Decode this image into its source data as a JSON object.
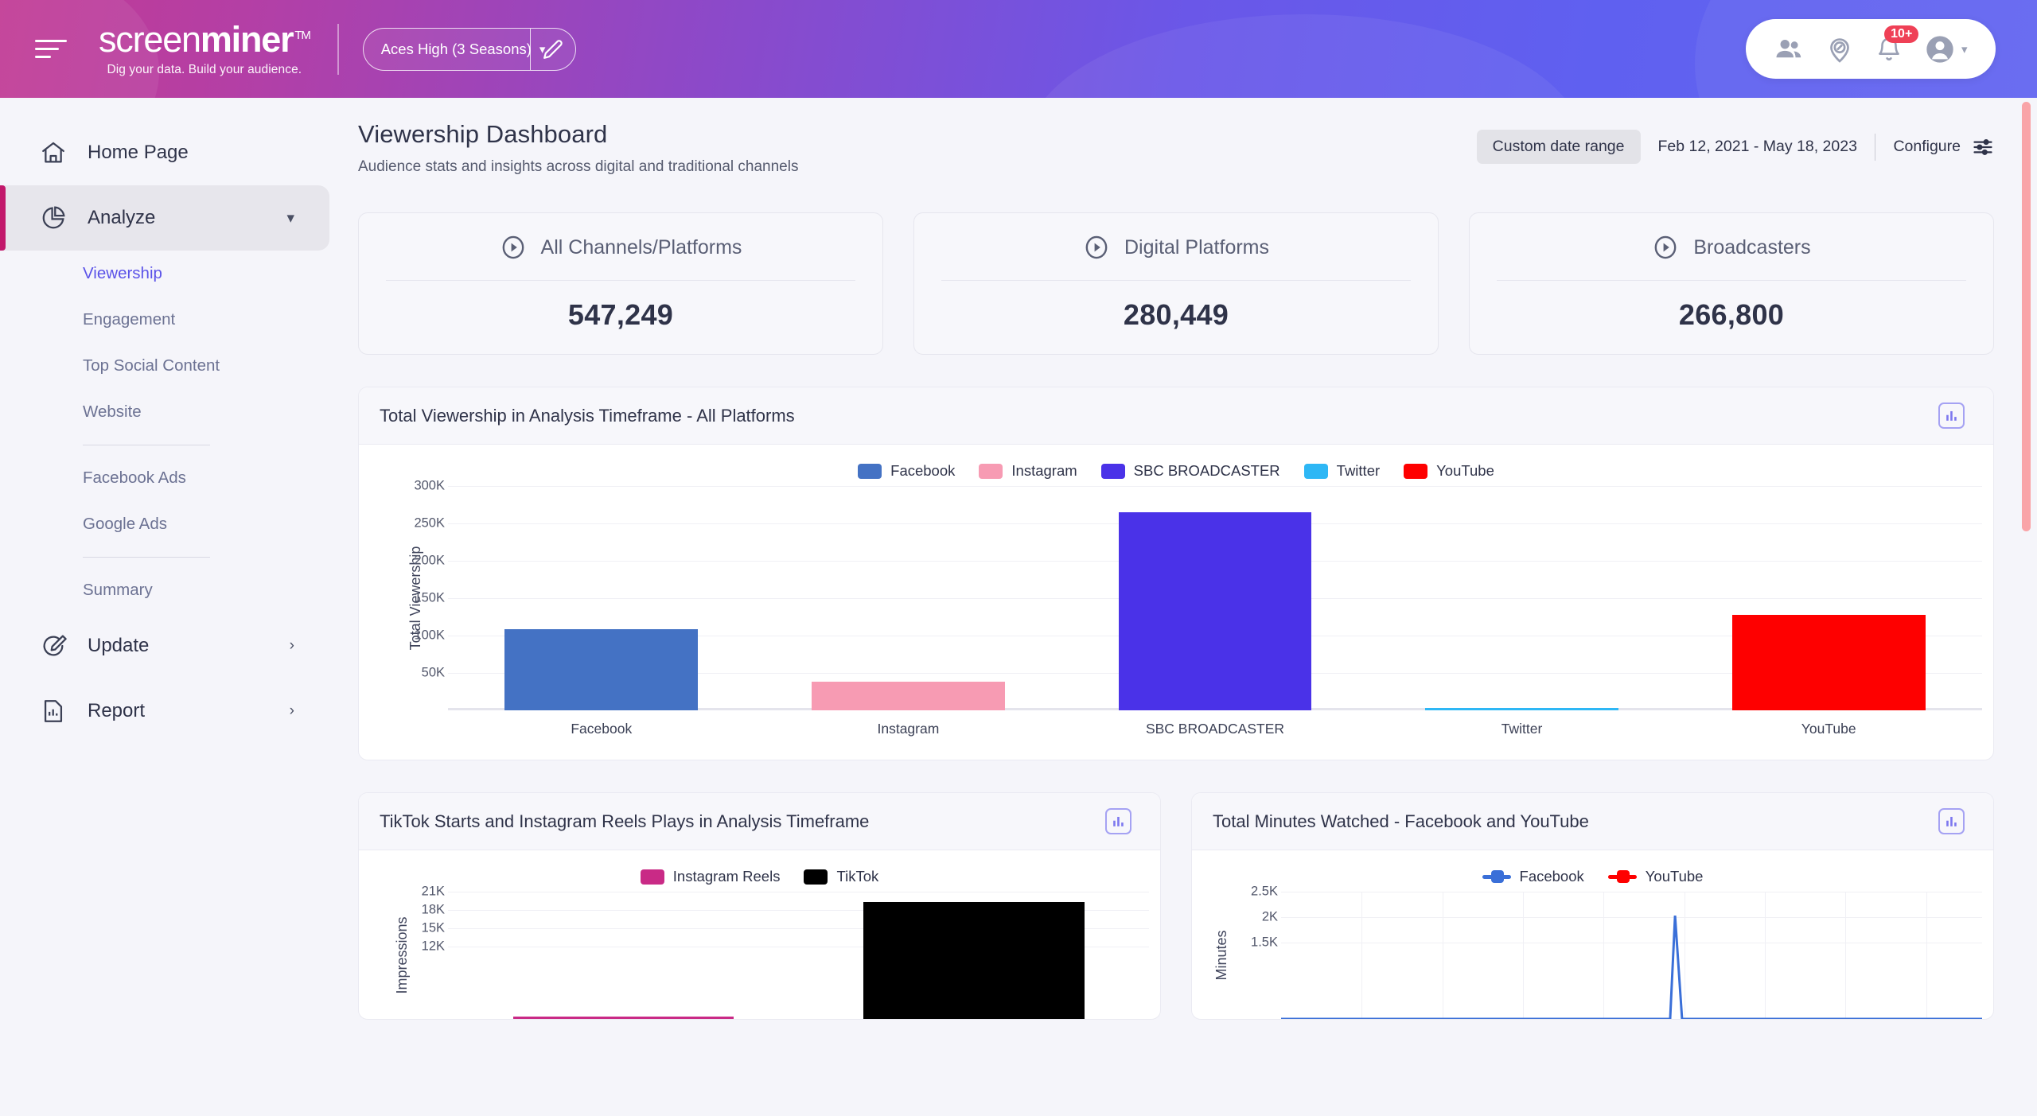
{
  "topbar": {
    "brand_part1": "screen",
    "brand_part2": "miner",
    "brand_tm": "TM",
    "tagline": "Dig your data. Build your audience.",
    "project_value": "Aces High (3 Seasons)",
    "notifications_badge": "10+"
  },
  "sidebar": {
    "home": "Home Page",
    "analyze": "Analyze",
    "sub_items": [
      "Viewership",
      "Engagement",
      "Top Social Content",
      "Website",
      "Facebook Ads",
      "Google Ads",
      "Summary"
    ],
    "selected_sub": "Viewership",
    "update": "Update",
    "report": "Report"
  },
  "page": {
    "title": "Viewership Dashboard",
    "subtitle": "Audience stats and insights across digital and traditional channels",
    "date_pill": "Custom date range",
    "date_range": "Feb 12, 2021 - May 18, 2023",
    "configure": "Configure"
  },
  "kpis": [
    {
      "title": "All Channels/Platforms",
      "value": "547,249"
    },
    {
      "title": "Digital Platforms",
      "value": "280,449"
    },
    {
      "title": "Broadcasters",
      "value": "266,800"
    }
  ],
  "chart_data": [
    {
      "type": "bar",
      "title": "Total Viewership in Analysis Timeframe - All Platforms",
      "xlabel": "",
      "ylabel": "Total Viewership",
      "categories": [
        "Facebook",
        "Instagram",
        "SBC BROADCASTER",
        "Twitter",
        "YouTube"
      ],
      "values": [
        109000,
        38000,
        265000,
        1000,
        128000
      ],
      "colors": [
        "#4472c4",
        "#f79bb3",
        "#4a32e8",
        "#2eb7f5",
        "#fe0000"
      ],
      "legend": [
        {
          "name": "Facebook",
          "color": "#4472c4"
        },
        {
          "name": "Instagram",
          "color": "#f79bb3"
        },
        {
          "name": "SBC BROADCASTER",
          "color": "#4a32e8"
        },
        {
          "name": "Twitter",
          "color": "#2eb7f5"
        },
        {
          "name": "YouTube",
          "color": "#fe0000"
        }
      ],
      "legend_position": "top",
      "grid": true,
      "ylim": [
        0,
        300000
      ],
      "yticks": [
        "300K",
        "250K",
        "200K",
        "150K",
        "100K",
        "50K"
      ],
      "ytick_values": [
        300000,
        250000,
        200000,
        150000,
        100000,
        50000
      ]
    },
    {
      "type": "bar",
      "title": "TikTok Starts and Instagram Reels Plays in Analysis Timeframe",
      "xlabel": "",
      "ylabel": "Impressions",
      "categories": [
        "Instagram Reels",
        "TikTok"
      ],
      "values": [
        0,
        19300
      ],
      "colors": [
        "#c92a86",
        "#000000"
      ],
      "legend": [
        {
          "name": "Instagram Reels",
          "color": "#c92a86"
        },
        {
          "name": "TikTok",
          "color": "#000000"
        }
      ],
      "legend_position": "top",
      "grid": true,
      "ylim": [
        0,
        21000
      ],
      "yticks": [
        "21K",
        "18K",
        "15K",
        "12K"
      ],
      "ytick_values": [
        21000,
        18000,
        15000,
        12000
      ]
    },
    {
      "type": "line",
      "title": "Total Minutes Watched - Facebook and YouTube",
      "xlabel": "",
      "ylabel": "Minutes",
      "series": [
        {
          "name": "Facebook",
          "color": "#3a6fd8",
          "peak": 2030
        },
        {
          "name": "YouTube",
          "color": "#fe0000",
          "peak": 0
        }
      ],
      "legend": [
        {
          "name": "Facebook",
          "color": "#3a6fd8"
        },
        {
          "name": "YouTube",
          "color": "#fe0000"
        }
      ],
      "legend_position": "top",
      "grid": true,
      "ylim": [
        0,
        2500
      ],
      "yticks": [
        "2.5K",
        "2K",
        "1.5K"
      ],
      "ytick_values": [
        2500,
        2000,
        1500
      ]
    }
  ]
}
